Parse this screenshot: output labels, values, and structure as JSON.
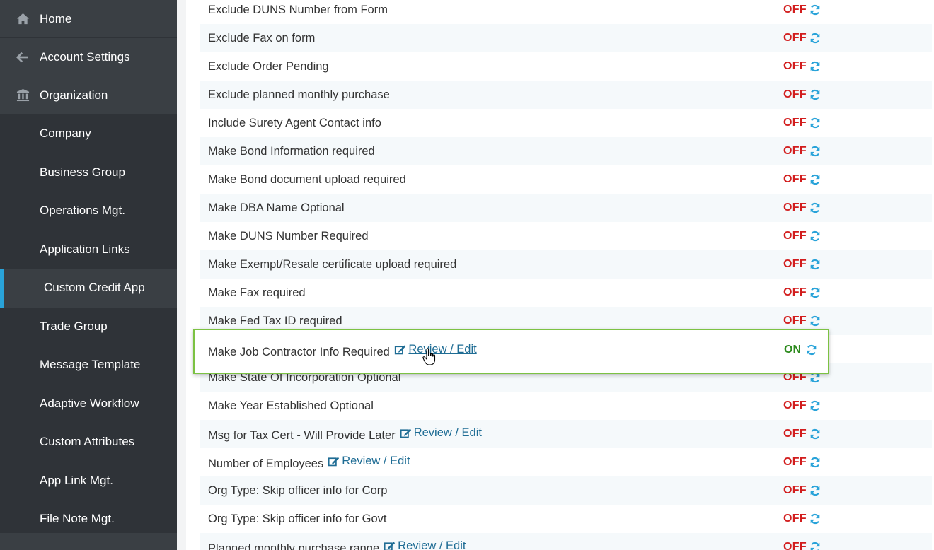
{
  "sidebar": {
    "top_items": [
      {
        "label": "Home",
        "icon": "home-icon"
      },
      {
        "label": "Account Settings",
        "icon": "arrow-left-icon"
      },
      {
        "label": "Organization",
        "icon": "bank-icon"
      }
    ],
    "sub_items": [
      {
        "label": "Company"
      },
      {
        "label": "Business Group"
      },
      {
        "label": "Operations Mgt."
      },
      {
        "label": "Application Links"
      },
      {
        "label": "Custom Credit App",
        "active": true
      },
      {
        "label": "Trade Group"
      },
      {
        "label": "Message Template"
      },
      {
        "label": "Adaptive Workflow"
      },
      {
        "label": "Custom Attributes"
      },
      {
        "label": "App Link Mgt."
      },
      {
        "label": "File Note Mgt."
      }
    ]
  },
  "settings": {
    "review_label": "Review / Edit",
    "rows": [
      {
        "label": "Exclude DUNS Number from Form",
        "status": "OFF"
      },
      {
        "label": "Exclude Fax on form",
        "status": "OFF"
      },
      {
        "label": "Exclude Order Pending",
        "status": "OFF"
      },
      {
        "label": "Exclude planned monthly purchase",
        "status": "OFF"
      },
      {
        "label": "Include Surety Agent Contact info",
        "status": "OFF"
      },
      {
        "label": "Make Bond Information required",
        "status": "OFF"
      },
      {
        "label": "Make Bond document upload required",
        "status": "OFF"
      },
      {
        "label": "Make DBA Name Optional",
        "status": "OFF"
      },
      {
        "label": "Make DUNS Number Required",
        "status": "OFF"
      },
      {
        "label": "Make Exempt/Resale certificate upload required",
        "status": "OFF"
      },
      {
        "label": "Make Fax required",
        "status": "OFF"
      },
      {
        "label": "Make Fed Tax ID required",
        "status": "OFF"
      },
      {
        "label": "Make Job Contractor Info Required",
        "status": "ON",
        "review": true
      },
      {
        "label": "Make State Of Incorporation Optional",
        "status": "OFF"
      },
      {
        "label": "Make Year Established Optional",
        "status": "OFF"
      },
      {
        "label": "Msg for Tax Cert - Will Provide Later",
        "status": "OFF",
        "review": true
      },
      {
        "label": "Number of Employees",
        "status": "OFF",
        "review": true
      },
      {
        "label": "Org Type: Skip officer info for Corp",
        "status": "OFF"
      },
      {
        "label": "Org Type: Skip officer info for Govt",
        "status": "OFF"
      },
      {
        "label": "Planned monthly purchase range",
        "status": "OFF",
        "review": true
      }
    ]
  },
  "highlighted": {
    "label": "Make Job Contractor Info Required",
    "review_label": "Review / Edit",
    "status": "ON"
  },
  "colors": {
    "sidebar_bg": "#2f3338",
    "accent": "#29a3d9",
    "off": "#d21d1d",
    "on": "#2e8b1e",
    "link": "#1e6c94",
    "highlight_border": "#7cc243"
  }
}
